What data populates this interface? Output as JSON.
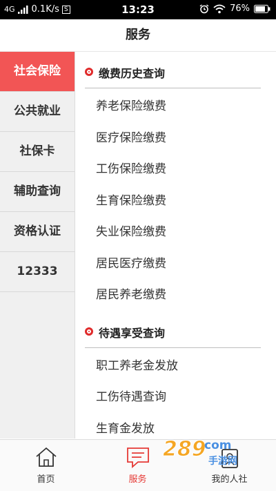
{
  "status_bar": {
    "network": "4G",
    "speed": "0.1K/s",
    "sim": "S",
    "time": "13:23",
    "battery": "76%"
  },
  "header": {
    "title": "服务"
  },
  "sidebar": {
    "items": [
      {
        "label": "社会保险",
        "active": true
      },
      {
        "label": "公共就业"
      },
      {
        "label": "社保卡"
      },
      {
        "label": "辅助查询"
      },
      {
        "label": "资格认证"
      },
      {
        "label": "12333"
      }
    ]
  },
  "content": {
    "sections": [
      {
        "title": "缴费历史查询",
        "items": [
          "养老保险缴费",
          "医疗保险缴费",
          "工伤保险缴费",
          "生育保险缴费",
          "失业保险缴费",
          "居民医疗缴费",
          "居民养老缴费"
        ]
      },
      {
        "title": "待遇享受查询",
        "items": [
          "职工养老金发放",
          "工伤待遇查询",
          "生育金发放"
        ]
      }
    ]
  },
  "bottom_nav": {
    "items": [
      {
        "label": "首页",
        "icon": "home-icon"
      },
      {
        "label": "服务",
        "icon": "chat-icon",
        "active": true
      },
      {
        "label": "我的人社",
        "icon": "profile-icon"
      }
    ]
  },
  "watermark": {
    "text": "289",
    "domain": "com",
    "sub": "手游网"
  },
  "colors": {
    "accent": "#f25555",
    "active_text": "#e53935"
  }
}
